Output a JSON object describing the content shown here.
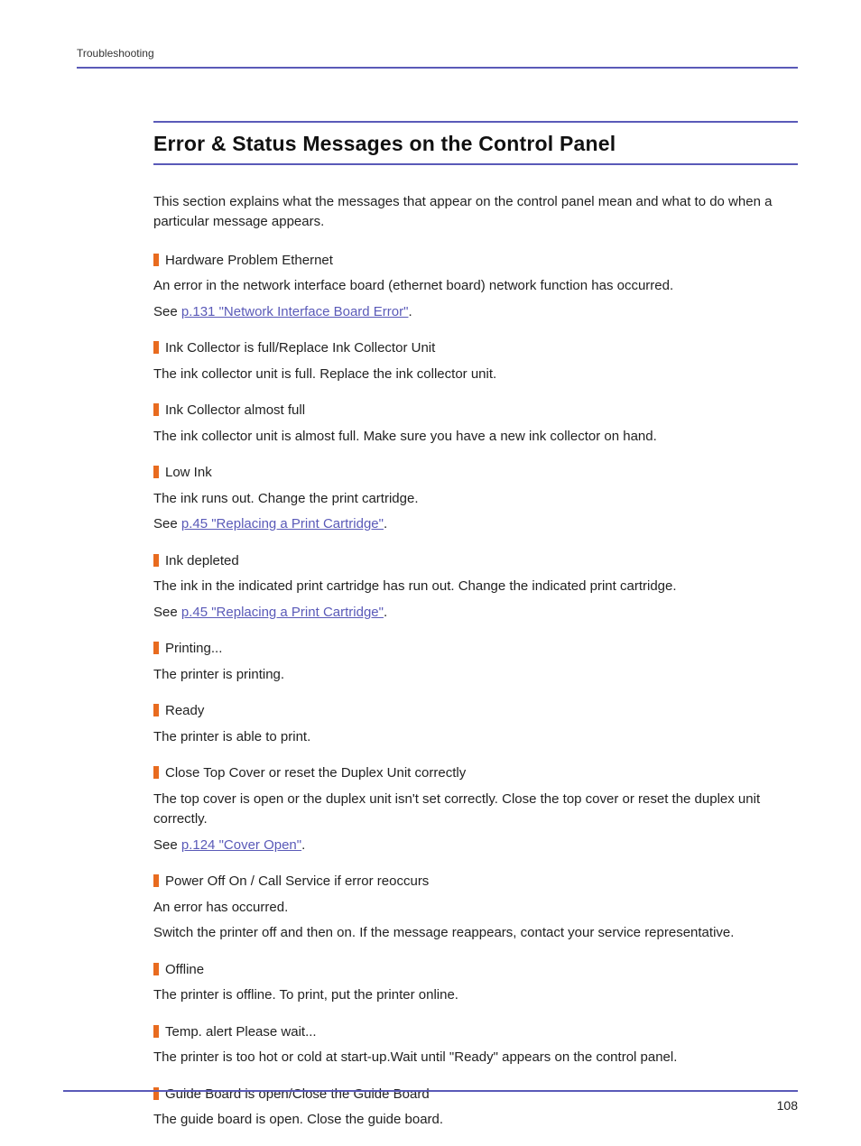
{
  "breadcrumb": "Troubleshooting",
  "title": "Error & Status Messages on the Control Panel",
  "intro": "This section explains what the messages that appear on the control panel mean and what to do when a particular message appears.",
  "see_label": "See ",
  "page_number": "108",
  "messages": [
    {
      "title": "Hardware Problem Ethernet",
      "desc": [
        "An error in the network interface board (ethernet board) network function has occurred."
      ],
      "link": "p.131 \"Network Interface Board Error\""
    },
    {
      "title": "Ink Collector is full/Replace Ink Collector Unit",
      "desc": [
        "The ink collector unit is full. Replace the ink collector unit."
      ]
    },
    {
      "title": "Ink Collector almost full",
      "desc": [
        "The ink collector unit is almost full. Make sure you have a new ink collector on hand."
      ]
    },
    {
      "title": "Low Ink",
      "desc": [
        "The ink runs out. Change the print cartridge."
      ],
      "link": "p.45 \"Replacing a Print Cartridge\""
    },
    {
      "title": "Ink depleted",
      "desc": [
        "The ink in the indicated print cartridge has run out. Change the indicated print cartridge."
      ],
      "link": "p.45 \"Replacing a Print Cartridge\""
    },
    {
      "title": "Printing...",
      "desc": [
        "The printer is printing."
      ]
    },
    {
      "title": "Ready",
      "desc": [
        "The printer is able to print."
      ]
    },
    {
      "title": "Close Top Cover or reset the Duplex Unit correctly",
      "desc": [
        "The top cover is open or the duplex unit isn't set correctly. Close the top cover or reset the duplex unit correctly."
      ],
      "link": "p.124 \"Cover Open\""
    },
    {
      "title": "Power Off On / Call Service if error reoccurs",
      "desc": [
        "An error has occurred.",
        "Switch the printer off and then on. If the message reappears, contact your service representative."
      ]
    },
    {
      "title": "Offline",
      "desc": [
        "The printer is offline. To print, put the printer online."
      ]
    },
    {
      "title": "Temp. alert Please wait...",
      "desc": [
        "The printer is too hot or cold at start-up.Wait until \"Ready\" appears on the control panel."
      ]
    },
    {
      "title": "Guide Board is open/Close the Guide Board",
      "desc": [
        "The guide board is open. Close the guide board."
      ]
    }
  ]
}
